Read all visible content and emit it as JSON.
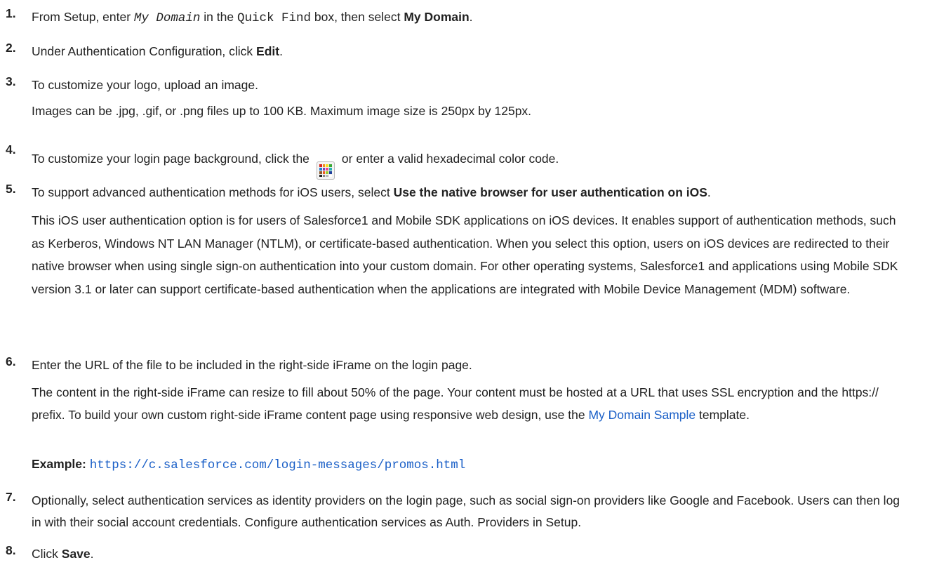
{
  "steps": [
    {
      "num": "1.",
      "t1": "From Setup, enter ",
      "code1": "My Domain",
      "t2": " in the ",
      "code2": "Quick Find",
      "t3": " box, then select ",
      "bold": "My Domain",
      "t4": "."
    },
    {
      "num": "2.",
      "t1": "Under Authentication Configuration, click ",
      "bold": "Edit",
      "t2": "."
    },
    {
      "num": "3.",
      "text": "To customize your logo, upload an image.",
      "note": "Images can be .jpg, .gif, or .png files up to 100 KB. Maximum image size is 250px by 125px."
    },
    {
      "num": "4.",
      "t1": "To customize your login page background, click the",
      "icon": "color-picker-icon",
      "t2": "or enter a valid hexadecimal color code."
    },
    {
      "num": "5.",
      "t1": "To support advanced authentication methods for iOS users, select ",
      "bold": "Use the native browser for user authentication on iOS",
      "t2": ".",
      "note": "This iOS user authentication option is for users of Salesforce1 and Mobile SDK applications on iOS devices. It enables support of authentication methods, such as Kerberos, Windows NT LAN Manager (NTLM), or certificate-based authentication. When you select this option, users on iOS devices are redirected to their native browser when using single sign-on authentication into your custom domain. For other operating systems, Salesforce1 and applications using Mobile SDK version 3.1 or later can support certificate-based authentication when the applications are integrated with Mobile Device Management (MDM) software."
    },
    {
      "num": "6.",
      "text": "Enter the URL of the file to be included in the right-side iFrame on the login page.",
      "note1": "The content in the right-side iFrame can resize to fill about 50% of the page. Your content must be hosted at a URL that uses SSL encryption and the https:// prefix. To build your own custom right-side iFrame content page using responsive web design, use the ",
      "link": "My Domain Sample",
      "note2": " template.",
      "example_label": "Example:",
      "example_url": "https://c.salesforce.com/login-messages/promos.html"
    },
    {
      "num": "7.",
      "text": "Optionally, select authentication services as identity providers on the login page, such as social sign-on providers like Google and Facebook. Users can then log in with their social account credentials. Configure authentication services as Auth. Providers in Setup."
    },
    {
      "num": "8.",
      "t1": "Click ",
      "bold": "Save",
      "t2": "."
    }
  ],
  "colors": {
    "text": "#222222",
    "link": "#1a5fc7",
    "picker_swatches": [
      "#d7261e",
      "#f28c1e",
      "#f7e11b",
      "#3aa935",
      "#1d7fd1",
      "#7a3fb5",
      "#e64c8c",
      "#28b2b6",
      "#8b5a2b",
      "#f05a24",
      "#9acd32",
      "#1f3f9b",
      "#222222",
      "#888888",
      "#bbbbbb",
      "#ffffff"
    ]
  }
}
